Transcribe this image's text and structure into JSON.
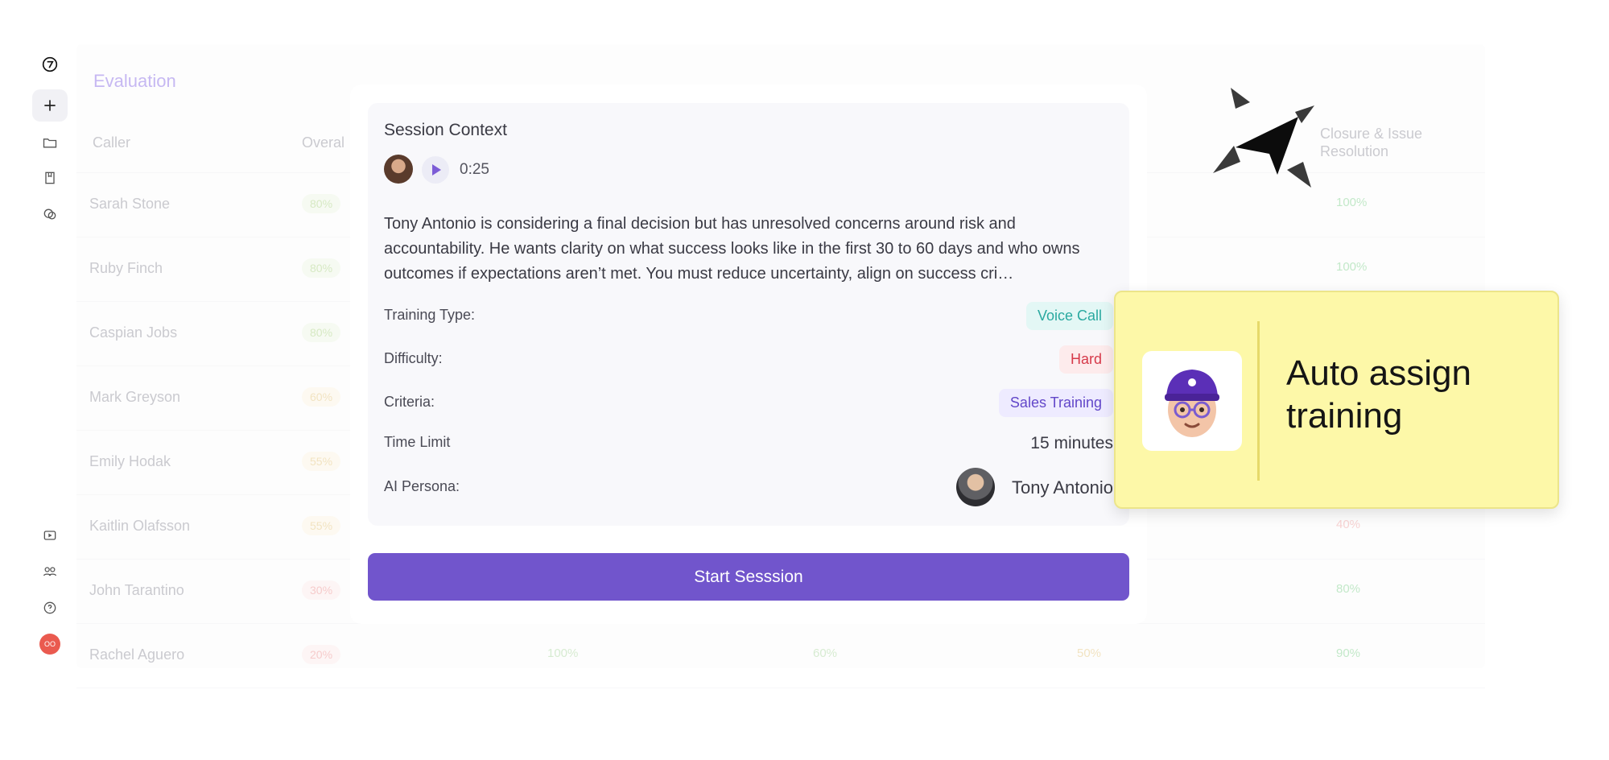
{
  "background": {
    "section_title": "Evaluation",
    "columns": [
      "Caller",
      "Overal",
      "Closure & Issue Resolution"
    ],
    "rows": [
      {
        "name": "Sarah Stone",
        "pct": "80%",
        "far": "100%"
      },
      {
        "name": "Ruby Finch",
        "pct": "80%",
        "far": "100%"
      },
      {
        "name": "Caspian Jobs",
        "pct": "80%",
        "far": ""
      },
      {
        "name": "Mark Greyson",
        "pct": "60%",
        "far": ""
      },
      {
        "name": "Emily Hodak",
        "pct": "55%",
        "far": ""
      },
      {
        "name": "Kaitlin Olafsson",
        "pct": "55%",
        "far": "40%"
      },
      {
        "name": "John Tarantino",
        "pct": "30%",
        "far": "80%"
      },
      {
        "name": "Rachel Aguero",
        "pct": "20%",
        "far": "90%",
        "mid": [
          "100%",
          "60%",
          "50%"
        ]
      }
    ]
  },
  "sidebar": {
    "icons": [
      "logo-icon",
      "plus-icon",
      "folder-icon",
      "book-icon",
      "chat-icon",
      "video-icon",
      "users-icon",
      "help-icon"
    ],
    "avatar_initials": "OO"
  },
  "modal": {
    "title": "Session Context",
    "duration": "0:25",
    "description": "Tony Antonio is considering a final decision but has unresolved concerns around risk and accountability. He wants clarity on what success looks like in the first 30 to 60 days and who owns outcomes if expectations aren’t met. You must reduce uncertainty, align on success cri…",
    "fields": {
      "training_type_label": "Training Type:",
      "training_type_value": "Voice Call",
      "difficulty_label": "Difficulty:",
      "difficulty_value": "Hard",
      "criteria_label": "Criteria:",
      "criteria_value": "Sales Training",
      "time_limit_label": "Time Limit",
      "time_limit_value": "15 minutes",
      "persona_label": "AI Persona:",
      "persona_value": "Tony Antonio"
    },
    "start_label": "Start Sesssion",
    "colors": {
      "accent": "#7155cc",
      "voice": "#2aa9a0",
      "hard": "#d63a4a",
      "sales": "#6247c9"
    }
  },
  "callout": {
    "text": "Auto assign training",
    "background": "#fdf8a8"
  }
}
